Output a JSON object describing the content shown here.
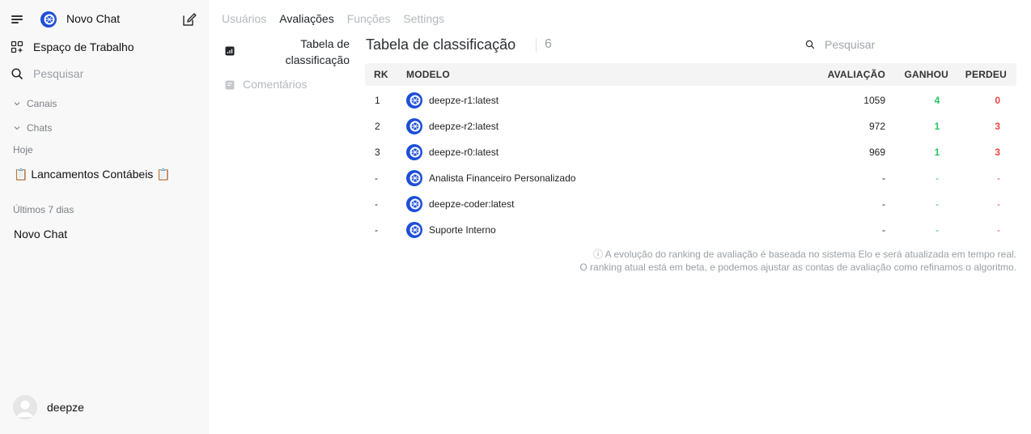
{
  "sidebar": {
    "app_title": "Novo Chat",
    "workspace_label": "Espaço de Trabalho",
    "search_label": "Pesquisar",
    "sections": {
      "channels": "Canais",
      "chats": "Chats"
    },
    "groups": [
      {
        "label": "Hoje",
        "items": [
          "📋 Lancamentos Contábeis 📋"
        ]
      },
      {
        "label": "Últimos 7 dias",
        "items": [
          "Novo Chat"
        ]
      }
    ],
    "user_name": "deepze"
  },
  "tabs": [
    {
      "label": "Usuários",
      "active": false
    },
    {
      "label": "Avaliações",
      "active": true
    },
    {
      "label": "Funções",
      "active": false
    },
    {
      "label": "Settings",
      "active": false
    }
  ],
  "subnav": {
    "leaderboard_label": "Tabela de classificação",
    "feedback_label": "Comentários"
  },
  "leaderboard": {
    "title": "Tabela de classificação",
    "count": "6",
    "search_placeholder": "Pesquisar",
    "columns": {
      "rank": "RK",
      "model": "MODELO",
      "rating": "AVALIAÇÃO",
      "won": "GANHOU",
      "lost": "PERDEU"
    },
    "rows": [
      {
        "rank": "1",
        "model": "deepze-r1:latest",
        "rating": "1059",
        "won": "4",
        "lost": "0"
      },
      {
        "rank": "2",
        "model": "deepze-r2:latest",
        "rating": "972",
        "won": "1",
        "lost": "3"
      },
      {
        "rank": "3",
        "model": "deepze-r0:latest",
        "rating": "969",
        "won": "1",
        "lost": "3"
      },
      {
        "rank": "-",
        "model": "Analista Financeiro Personalizado",
        "rating": "-",
        "won": "-",
        "lost": "-"
      },
      {
        "rank": "-",
        "model": "deepze-coder:latest",
        "rating": "-",
        "won": "-",
        "lost": "-"
      },
      {
        "rank": "-",
        "model": "Suporte Interno",
        "rating": "-",
        "won": "-",
        "lost": "-"
      }
    ],
    "note_line1": "ⓘ A evolução do ranking de avaliação é baseada no sistema Elo e será atualizada em tempo real.",
    "note_line2": "O ranking atual está em beta, e podemos ajustar as contas de avaliação como refinamos o algoritmo."
  },
  "colors": {
    "won": "#22c55e",
    "lost": "#ef4444",
    "logo_blue": "#1d4ed8"
  },
  "icons": {
    "menu": "menu-icon",
    "logo": "model-logo-icon",
    "edit": "edit-icon",
    "workspace": "grid-plus-icon",
    "search": "search-icon",
    "chevron": "chevron-down-icon",
    "leaderboard": "chart-bar-icon",
    "feedback": "chat-bubble-icon"
  }
}
